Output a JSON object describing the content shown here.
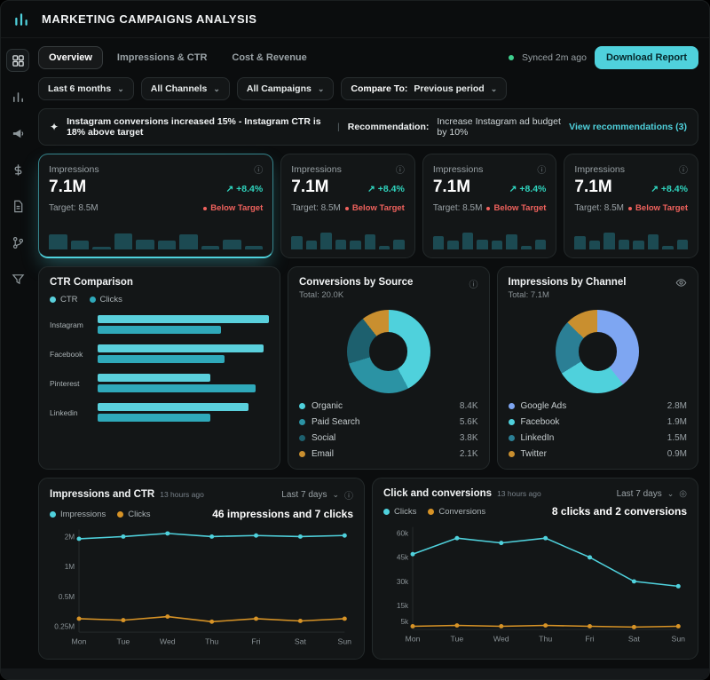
{
  "header": {
    "title": "MARKETING CAMPAIGNS ANALYSIS"
  },
  "sidebar": {
    "icons": [
      "dashboard-icon",
      "bar-chart-icon",
      "megaphone-icon",
      "dollar-icon",
      "document-icon",
      "git-branch-icon",
      "filter-icon"
    ]
  },
  "toolbar": {
    "tabs": [
      {
        "label": "Overview",
        "active": true
      },
      {
        "label": "Impressions & CTR",
        "active": false
      },
      {
        "label": "Cost & Revenue",
        "active": false
      }
    ],
    "synced": "Synced 2m ago",
    "download": "Download Report"
  },
  "filters": [
    {
      "label": "Last 6 months"
    },
    {
      "label": "All Channels"
    },
    {
      "label": "All Campaigns"
    },
    {
      "prefix": "Compare To:",
      "label": "Previous period"
    }
  ],
  "insight": {
    "headline": "Instagram conversions increased 15% - Instagram CTR is 18% above target",
    "divider": "|",
    "rec_label": "Recommendation:",
    "rec_text": "Increase Instagram ad budget by 10%",
    "link": "View recommendations (3)"
  },
  "kpi_cards": [
    {
      "title": "Impressions",
      "value": "7.1M",
      "delta_arrow": "↗",
      "delta": "+8.4%",
      "target": "Target: 8.5M",
      "status": "Below Target",
      "selected": true,
      "bars": [
        52,
        30,
        10,
        56,
        34,
        32,
        54,
        12,
        34,
        13
      ]
    },
    {
      "title": "Impressions",
      "value": "7.1M",
      "delta_arrow": "↗",
      "delta": "+8.4%",
      "target": "Target: 8.5M",
      "status": "Below Target",
      "selected": false,
      "bars": [
        46,
        30,
        58,
        34,
        32,
        52,
        12,
        33
      ]
    },
    {
      "title": "Impressions",
      "value": "7.1M",
      "delta_arrow": "↗",
      "delta": "+8.4%",
      "target": "Target: 8.5M",
      "status": "Below Target",
      "selected": false,
      "bars": [
        46,
        30,
        58,
        34,
        32,
        52,
        12,
        33
      ]
    },
    {
      "title": "Impressions",
      "value": "7.1M",
      "delta_arrow": "↗",
      "delta": "+8.4%",
      "target": "Target: 8.5M",
      "status": "Below Target",
      "selected": false,
      "bars": [
        46,
        30,
        58,
        34,
        32,
        52,
        12,
        33
      ]
    }
  ],
  "charts": {
    "ctr_comparison": {
      "type": "bar",
      "title": "CTR Comparison",
      "categories": [
        "Instagram",
        "Facebook",
        "Pinterest",
        "Linkedin"
      ],
      "series": [
        {
          "name": "CTR",
          "color": "#5ad0dc",
          "values": [
            100,
            97,
            66,
            88
          ]
        },
        {
          "name": "Clicks",
          "color": "#2fa9ba",
          "values": [
            72,
            74,
            92,
            66
          ]
        }
      ]
    },
    "conversions_by_source": {
      "type": "pie",
      "title": "Conversions by Source",
      "total": "Total: 20.0K",
      "segments": [
        {
          "label": "Organic",
          "value": "8.4K",
          "pct": 42.2,
          "color": "#4fd1dc"
        },
        {
          "label": "Paid Search",
          "value": "5.6K",
          "pct": 28.1,
          "color": "#2b93a4"
        },
        {
          "label": "Social",
          "value": "3.8K",
          "pct": 19.1,
          "color": "#1d606e"
        },
        {
          "label": "Email",
          "value": "2.1K",
          "pct": 10.6,
          "color": "#c98f2f"
        }
      ]
    },
    "impressions_by_channel": {
      "type": "pie",
      "title": "Impressions by Channel",
      "total": "Total: 7.1M",
      "segments": [
        {
          "label": "Google Ads",
          "value": "2.8M",
          "pct": 39.4,
          "color": "#7ea6f2"
        },
        {
          "label": "Facebook",
          "value": "1.9M",
          "pct": 26.8,
          "color": "#4fd1dc"
        },
        {
          "label": "LinkedIn",
          "value": "1.5M",
          "pct": 21.1,
          "color": "#2b7f95"
        },
        {
          "label": "Twitter",
          "value": "0.9M",
          "pct": 12.7,
          "color": "#c98f2f"
        }
      ]
    },
    "impressions_and_ctr": {
      "type": "line",
      "title": "Impressions and CTR",
      "updated": "13 hours ago",
      "range": "Last 7 days",
      "summary": "46 impressions and 7 clicks",
      "x": [
        "Mon",
        "Tue",
        "Wed",
        "Thu",
        "Fri",
        "Sat",
        "Sun"
      ],
      "scale": "log",
      "ymin": 0.22,
      "ymax": 2.35,
      "yticks": [
        {
          "v": 2,
          "label": "2M"
        },
        {
          "v": 1,
          "label": "1M"
        },
        {
          "v": 0.5,
          "label": "0.5M"
        },
        {
          "v": 0.25,
          "label": "0.25M"
        }
      ],
      "series": [
        {
          "name": "Impressions",
          "color": "#4fd1dc",
          "values": [
            1.9,
            2.0,
            2.15,
            2.0,
            2.05,
            2.0,
            2.05
          ]
        },
        {
          "name": "Clicks",
          "color": "#d79326",
          "values": [
            0.3,
            0.29,
            0.315,
            0.28,
            0.3,
            0.285,
            0.3
          ]
        }
      ]
    },
    "click_and_conversions": {
      "type": "line",
      "title": "Click and conversions",
      "updated": "13 hours ago",
      "range": "Last 7 days",
      "summary": "8 clicks and 2 conversions",
      "x": [
        "Mon",
        "Tue",
        "Wed",
        "Thu",
        "Fri",
        "Sat",
        "Sun"
      ],
      "scale": "linear",
      "ymin": 0,
      "ymax": 64,
      "yticks": [
        {
          "v": 60,
          "label": "60k"
        },
        {
          "v": 45,
          "label": "45k"
        },
        {
          "v": 30,
          "label": "30k"
        },
        {
          "v": 15,
          "label": "15k"
        },
        {
          "v": 5,
          "label": "5k"
        }
      ],
      "series": [
        {
          "name": "Clicks",
          "color": "#4fd1dc",
          "values": [
            47,
            57,
            54,
            57,
            45,
            30,
            27
          ]
        },
        {
          "name": "Conversions",
          "color": "#d79326",
          "values": [
            2,
            2.5,
            2,
            2.5,
            2,
            1.5,
            2
          ]
        }
      ]
    }
  },
  "colors": {
    "accent": "#4fd1dc",
    "orange": "#d79326",
    "negative": "#f0625d",
    "positive": "#2fd4be"
  }
}
